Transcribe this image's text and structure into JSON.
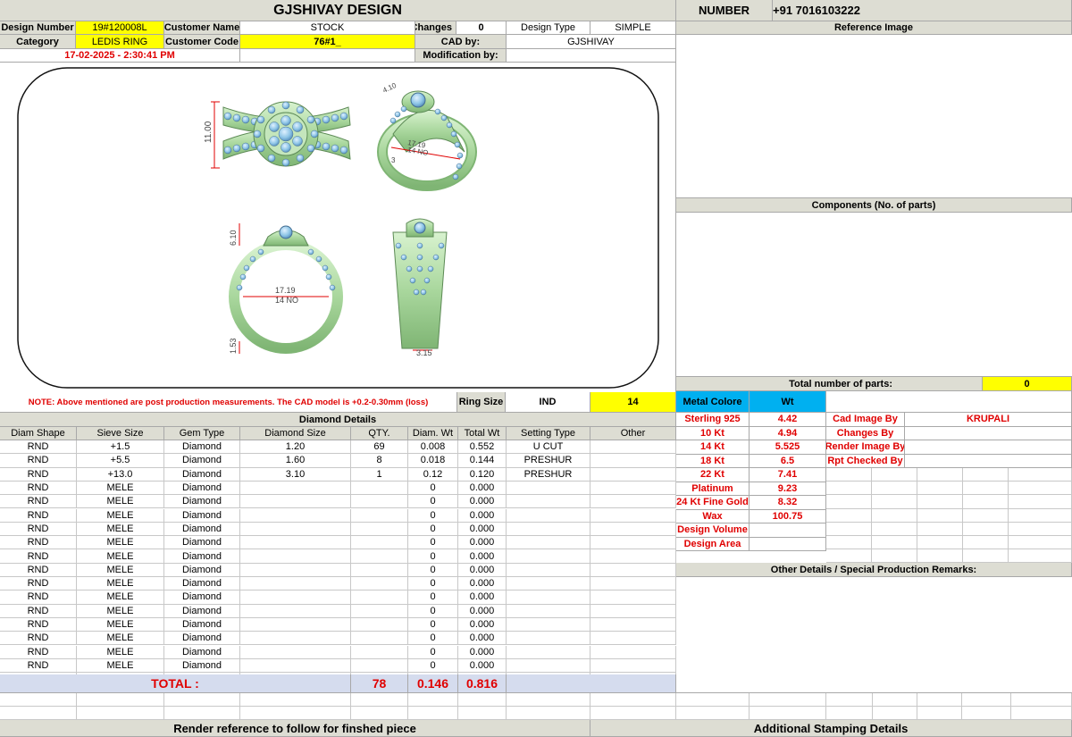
{
  "header": {
    "title": "GJSHIVAY DESIGN",
    "number_label": "NUMBER",
    "number_value": "+91 7016103222"
  },
  "info": {
    "design_number_label": "Design Number",
    "design_number": "19#120008L",
    "customer_name_label": "Customer Name",
    "customer_name": "STOCK",
    "changes_label": "Changes",
    "changes": "0",
    "design_type_label": "Design Type",
    "design_type": "SIMPLE",
    "category_label": "Category",
    "category": "LEDIS RING",
    "customer_code_label": "Customer Code",
    "customer_code": "76#1_",
    "cad_by_label": "CAD by:",
    "cad_by": "GJSHIVAY",
    "datetime": "17-02-2025 - 2:30:41 PM",
    "modification_label": "Modification by:",
    "modification": ""
  },
  "drawing": {
    "dim_height": "11.00",
    "dim_top_width": "4.10",
    "dim_side": "17.19",
    "dim_side_no": "14 NO",
    "dim_side_small": "3",
    "dim_front_top": "6.10",
    "dim_inner": "17.19",
    "dim_inner_no": "14 NO",
    "dim_shank": "1.53",
    "dim_band": "3.15"
  },
  "note": {
    "text": "NOTE: Above mentioned are post production measurements. The CAD model is +0.2-0.30mm (loss)",
    "ring_size_label": "Ring Size",
    "ring_size_std": "IND",
    "ring_size": "14"
  },
  "diamond": {
    "title": "Diamond Details",
    "columns": [
      "Diam Shape",
      "Sieve Size",
      "Gem Type",
      "Diamond Size",
      "QTY.",
      "Diam. Wt",
      "Total Wt",
      "Setting Type",
      "Other"
    ],
    "rows": [
      [
        "RND",
        "+1.5",
        "Diamond",
        "1.20",
        "69",
        "0.008",
        "0.552",
        "U CUT",
        ""
      ],
      [
        "RND",
        "+5.5",
        "Diamond",
        "1.60",
        "8",
        "0.018",
        "0.144",
        "PRESHUR",
        ""
      ],
      [
        "RND",
        "+13.0",
        "Diamond",
        "3.10",
        "1",
        "0.12",
        "0.120",
        "PRESHUR",
        ""
      ],
      [
        "RND",
        "MELE",
        "Diamond",
        "",
        "",
        "0",
        "0.000",
        "",
        ""
      ],
      [
        "RND",
        "MELE",
        "Diamond",
        "",
        "",
        "0",
        "0.000",
        "",
        ""
      ],
      [
        "RND",
        "MELE",
        "Diamond",
        "",
        "",
        "0",
        "0.000",
        "",
        ""
      ],
      [
        "RND",
        "MELE",
        "Diamond",
        "",
        "",
        "0",
        "0.000",
        "",
        ""
      ],
      [
        "RND",
        "MELE",
        "Diamond",
        "",
        "",
        "0",
        "0.000",
        "",
        ""
      ],
      [
        "RND",
        "MELE",
        "Diamond",
        "",
        "",
        "0",
        "0.000",
        "",
        ""
      ],
      [
        "RND",
        "MELE",
        "Diamond",
        "",
        "",
        "0",
        "0.000",
        "",
        ""
      ],
      [
        "RND",
        "MELE",
        "Diamond",
        "",
        "",
        "0",
        "0.000",
        "",
        ""
      ],
      [
        "RND",
        "MELE",
        "Diamond",
        "",
        "",
        "0",
        "0.000",
        "",
        ""
      ],
      [
        "RND",
        "MELE",
        "Diamond",
        "",
        "",
        "0",
        "0.000",
        "",
        ""
      ],
      [
        "RND",
        "MELE",
        "Diamond",
        "",
        "",
        "0",
        "0.000",
        "",
        ""
      ],
      [
        "RND",
        "MELE",
        "Diamond",
        "",
        "",
        "0",
        "0.000",
        "",
        ""
      ],
      [
        "RND",
        "MELE",
        "Diamond",
        "",
        "",
        "0",
        "0.000",
        "",
        ""
      ],
      [
        "RND",
        "MELE",
        "Diamond",
        "",
        "",
        "0",
        "0.000",
        "",
        ""
      ],
      [
        "RND",
        "MELE",
        "Diamond",
        "",
        "",
        "0",
        "0.000",
        "",
        ""
      ]
    ],
    "total_label": "TOTAL :",
    "total_qty": "78",
    "total_diam_wt": "0.146",
    "total_wt": "0.816"
  },
  "right": {
    "reference_image_label": "Reference Image",
    "components_label": "Components (No. of parts)",
    "total_parts_label": "Total number of parts:",
    "total_parts": "0",
    "metal_colore_label": "Metal Colore",
    "wt_label": "Wt",
    "metals": [
      {
        "name": "Sterling 925",
        "wt": "4.42"
      },
      {
        "name": "10 Kt",
        "wt": "4.94"
      },
      {
        "name": "14 Kt",
        "wt": "5.525"
      },
      {
        "name": "18 Kt",
        "wt": "6.5"
      },
      {
        "name": "22 Kt",
        "wt": "7.41"
      },
      {
        "name": "Platinum",
        "wt": "9.23"
      },
      {
        "name": "24 Kt Fine Gold",
        "wt": "8.32"
      },
      {
        "name": "Wax",
        "wt": "100.75"
      },
      {
        "name": "Design Volume",
        "wt": ""
      },
      {
        "name": "Design Area",
        "wt": ""
      }
    ],
    "cad_image_by_label": "Cad Image By",
    "cad_image_by": "KRUPALI",
    "changes_by_label": "Changes By",
    "render_image_by_label": "Render Image By",
    "rpt_checked_by_label": "Rpt Checked By",
    "other_details_label": "Other Details / Special Production Remarks:"
  },
  "footer": {
    "render_reference": "Render reference to follow for finshed piece",
    "additional_stamping": "Additional Stamping Details"
  },
  "colors": {
    "yellow": "#ffff00",
    "header_gray": "#ddddd3",
    "total_blue": "#d5dcee",
    "metal_cyan": "#00b0f0",
    "red_text": "#e00000",
    "ring_green": "#b8e0b0",
    "diamond_blue": "#8cc4e6"
  }
}
